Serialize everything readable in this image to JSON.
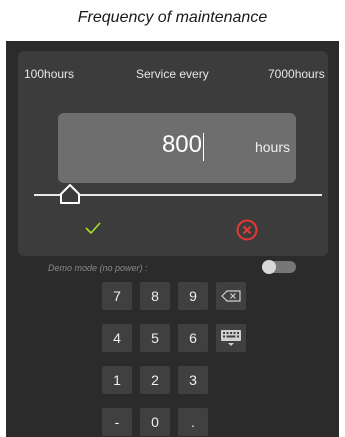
{
  "caption": "Frequency of maintenance",
  "dialog": {
    "min_label": "100hours",
    "title": "Service every",
    "max_label": "7000hours",
    "value": "800",
    "unit": "hours",
    "slider": {
      "min": 100,
      "max": 7000,
      "value": 800
    },
    "ok_icon": "check-icon",
    "cancel_icon": "close-circle-icon",
    "ok_color": "#a6e02d",
    "cancel_color": "#e53935"
  },
  "demo": {
    "label": "Demo mode (no power) :"
  },
  "keypad": {
    "keys": [
      "7",
      "8",
      "9",
      "4",
      "5",
      "6",
      "1",
      "2",
      "3",
      "-",
      "0",
      "."
    ],
    "backspace_icon": "backspace-icon",
    "hide_keyboard_icon": "keyboard-hide-icon"
  }
}
